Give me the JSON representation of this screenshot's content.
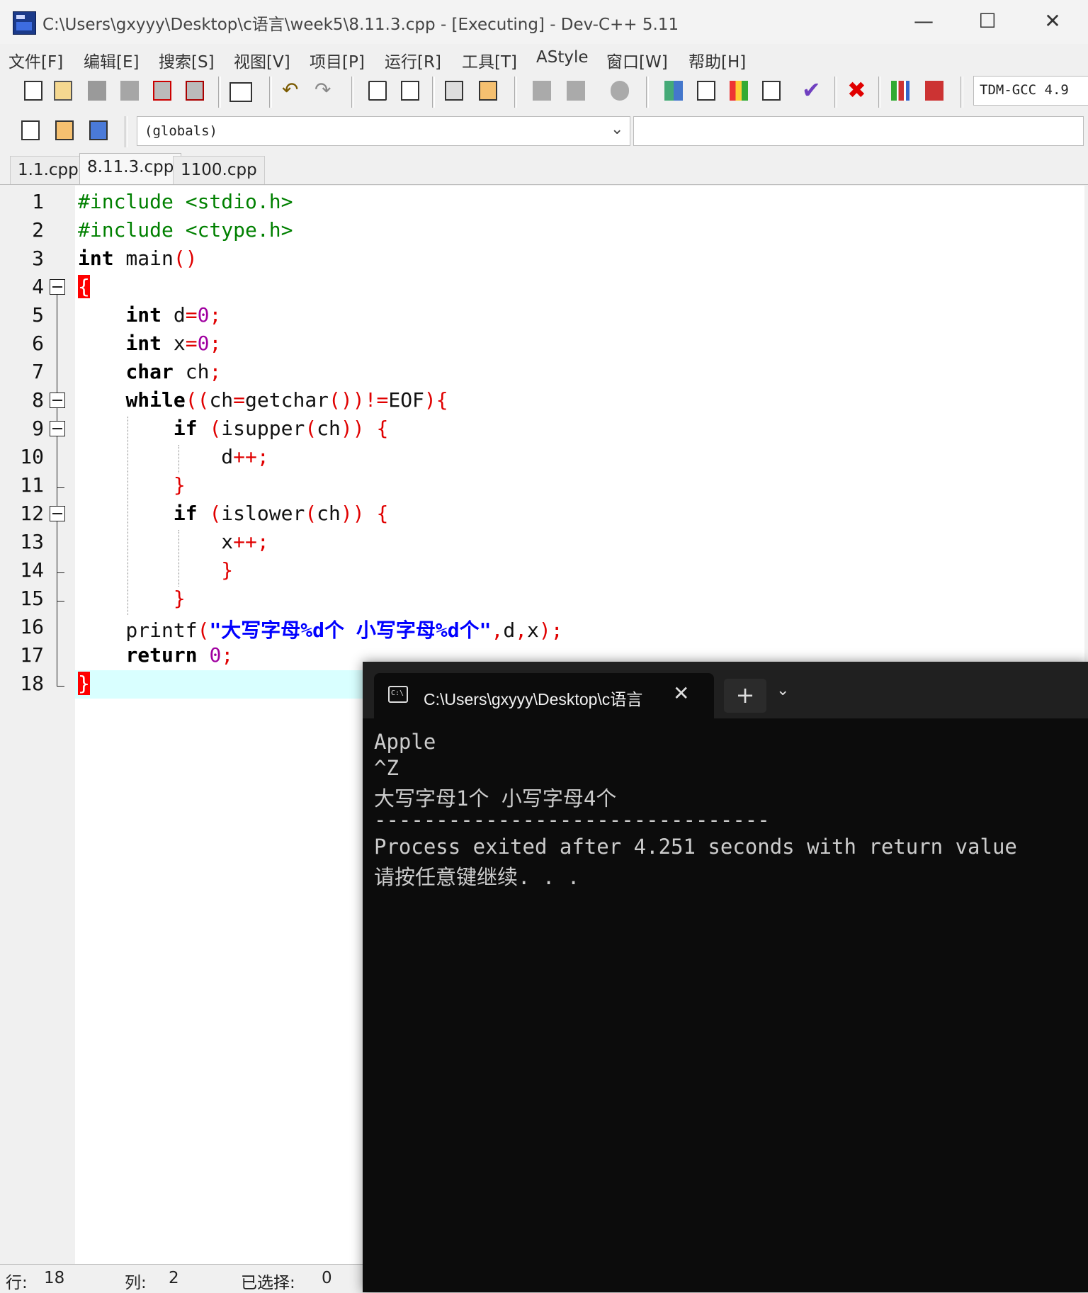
{
  "window": {
    "title": "C:\\Users\\gxyyy\\Desktop\\c语言\\week5\\8.11.3.cpp - [Executing] - Dev-C++ 5.11",
    "minimize": "—",
    "maximize": "☐",
    "close": "✕"
  },
  "menu": [
    "文件[F]",
    "编辑[E]",
    "搜索[S]",
    "视图[V]",
    "项目[P]",
    "运行[R]",
    "工具[T]",
    "AStyle",
    "窗口[W]",
    "帮助[H]"
  ],
  "toolbar": {
    "compiler": "TDM-GCC 4.9",
    "scope": "(globals)"
  },
  "tabs": [
    "1.1.cpp",
    "8.11.3.cpp",
    "1100.cpp"
  ],
  "active_tab": "8.11.3.cpp",
  "line_numbers": [
    "1",
    "2",
    "3",
    "4",
    "5",
    "6",
    "7",
    "8",
    "9",
    "10",
    "11",
    "12",
    "13",
    "14",
    "15",
    "16",
    "17",
    "18"
  ],
  "status": {
    "row_label": "行:",
    "row_value": "18",
    "col_label": "列:",
    "col_value": "2",
    "sel_label": "已选择:",
    "sel_value": "0"
  },
  "terminal": {
    "tab_title": "C:\\Users\\gxyyy\\Desktop\\c语言",
    "new_tab": "+",
    "dropdown": "⌄",
    "close": "✕",
    "output": [
      "Apple",
      "^Z",
      "大写字母1个 小写字母4个",
      "--------------------------------",
      "Process exited after 4.251 seconds with return value",
      "请按任意键继续. . ."
    ]
  }
}
